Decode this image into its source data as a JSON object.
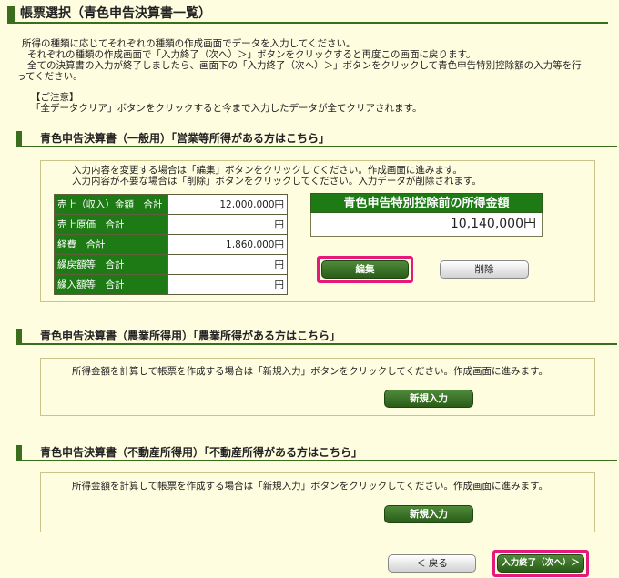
{
  "page_title": "帳票選択（青色申告決算書一覧）",
  "intro": [
    "所得の種類に応じてそれぞれの種類の作成画面でデータを入力してください。",
    "それぞれの種類の作成画面で「入力終了（次へ）＞」ボタンをクリックすると再度この画面に戻ります。",
    "全ての決算書の入力が終了しましたら、画面下の「入力終了（次へ）＞」ボタンをクリックして青色申告特別控除額の入力等を行",
    "ってください。"
  ],
  "notice": {
    "title": "【ご注意】",
    "text": "「全データクリア」ボタンをクリックすると今まで入力したデータが全てクリアされます。"
  },
  "sections": {
    "general": {
      "heading": "青色申告決算書（一般用）「営業等所得がある方はこちら」",
      "instructions": [
        "入力内容を変更する場合は「編集」ボタンをクリックしてください。作成画面に進みます。",
        "入力内容が不要な場合は「削除」ボタンをクリックしてください。入力データが削除されます。"
      ],
      "rows": [
        {
          "label": "売上（収入）金額　合計",
          "value": "12,000,000円"
        },
        {
          "label": "売上原価　合計",
          "value": "円"
        },
        {
          "label": "経費　合計",
          "value": "1,860,000円"
        },
        {
          "label": "繰戻額等　合計",
          "value": "円"
        },
        {
          "label": "繰入額等　合計",
          "value": "円"
        }
      ],
      "total_label": "青色申告特別控除前の所得金額",
      "total_value": "10,140,000円",
      "edit_button": "編集",
      "delete_button": "削除"
    },
    "agriculture": {
      "heading": "青色申告決算書（農業所得用）「農業所得がある方はこちら」",
      "instruction": "所得金額を計算して帳票を作成する場合は「新規入力」ボタンをクリックしてください。作成画面に進みます。",
      "new_button": "新規入力"
    },
    "real_estate": {
      "heading": "青色申告決算書（不動産所得用）「不動産所得がある方はこちら」",
      "instruction": "所得金額を計算して帳票を作成する場合は「新規入力」ボタンをクリックしてください。作成画面に進みます。",
      "new_button": "新規入力"
    }
  },
  "footer": {
    "back_button": "＜ 戻る",
    "next_button": "入力終了（次へ）＞"
  },
  "colors": {
    "background": "#fffde0",
    "accent_green": "#1e7a14",
    "highlight": "#e5197a"
  }
}
